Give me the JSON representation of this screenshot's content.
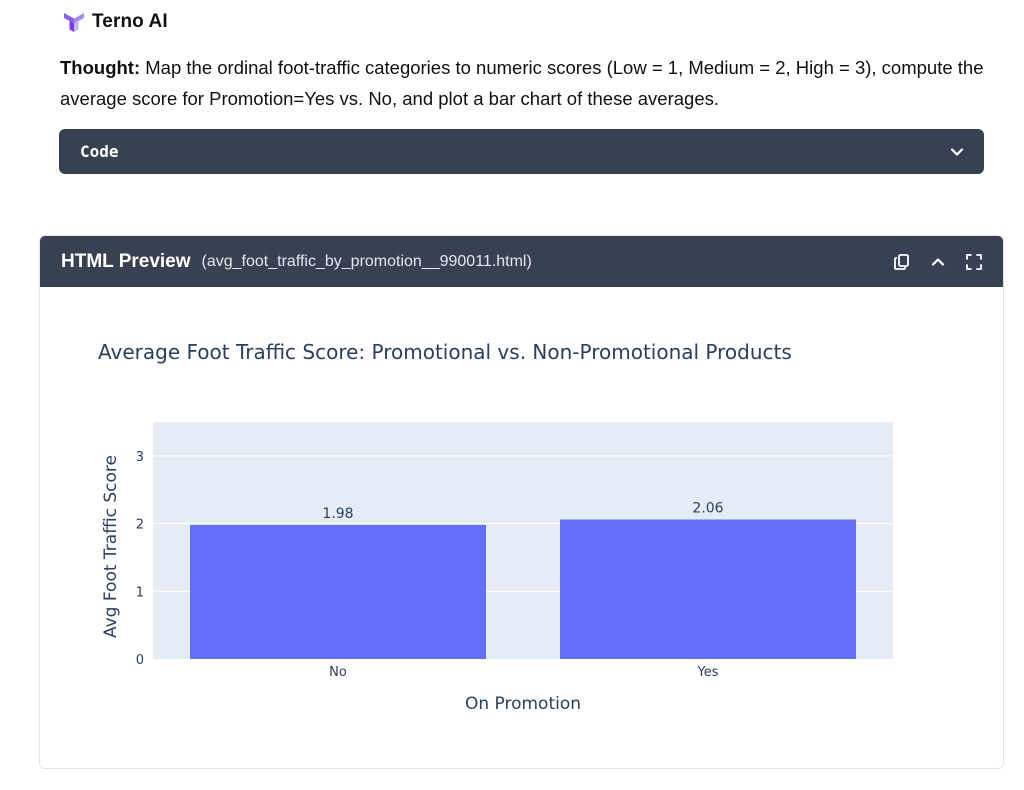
{
  "app": {
    "name": "Terno AI",
    "logo_icon": "terno-logo-icon",
    "logo_color": "#8b5cf6"
  },
  "thought": {
    "label": "Thought:",
    "text": " Map the ordinal foot-traffic categories to numeric scores (Low = 1, Medium = 2, High = 3), compute the average score for Promotion=Yes vs. No, and plot a bar chart of these averages."
  },
  "code_panel": {
    "label": "Code",
    "icon": "chevron-down-icon",
    "background": "#374151"
  },
  "preview": {
    "title": "HTML Preview",
    "filename": "(avg_foot_traffic_by_promotion__990011.html)",
    "actions": [
      "copy-icon",
      "chevron-up-icon",
      "fullscreen-icon"
    ]
  },
  "chart_data": {
    "type": "bar",
    "title": "Average Foot Traffic Score: Promotional vs. Non-Promotional Products",
    "xlabel": "On Promotion",
    "ylabel": "Avg Foot Traffic Score",
    "categories": [
      "No",
      "Yes"
    ],
    "values": [
      1.98,
      2.06
    ],
    "value_labels": [
      "1.98",
      "2.06"
    ],
    "ylim": [
      0,
      3.5
    ],
    "yticks": [
      0,
      1,
      2,
      3
    ],
    "grid": true,
    "bar_color": "#636efa",
    "plot_background": "#e5ecf6"
  }
}
